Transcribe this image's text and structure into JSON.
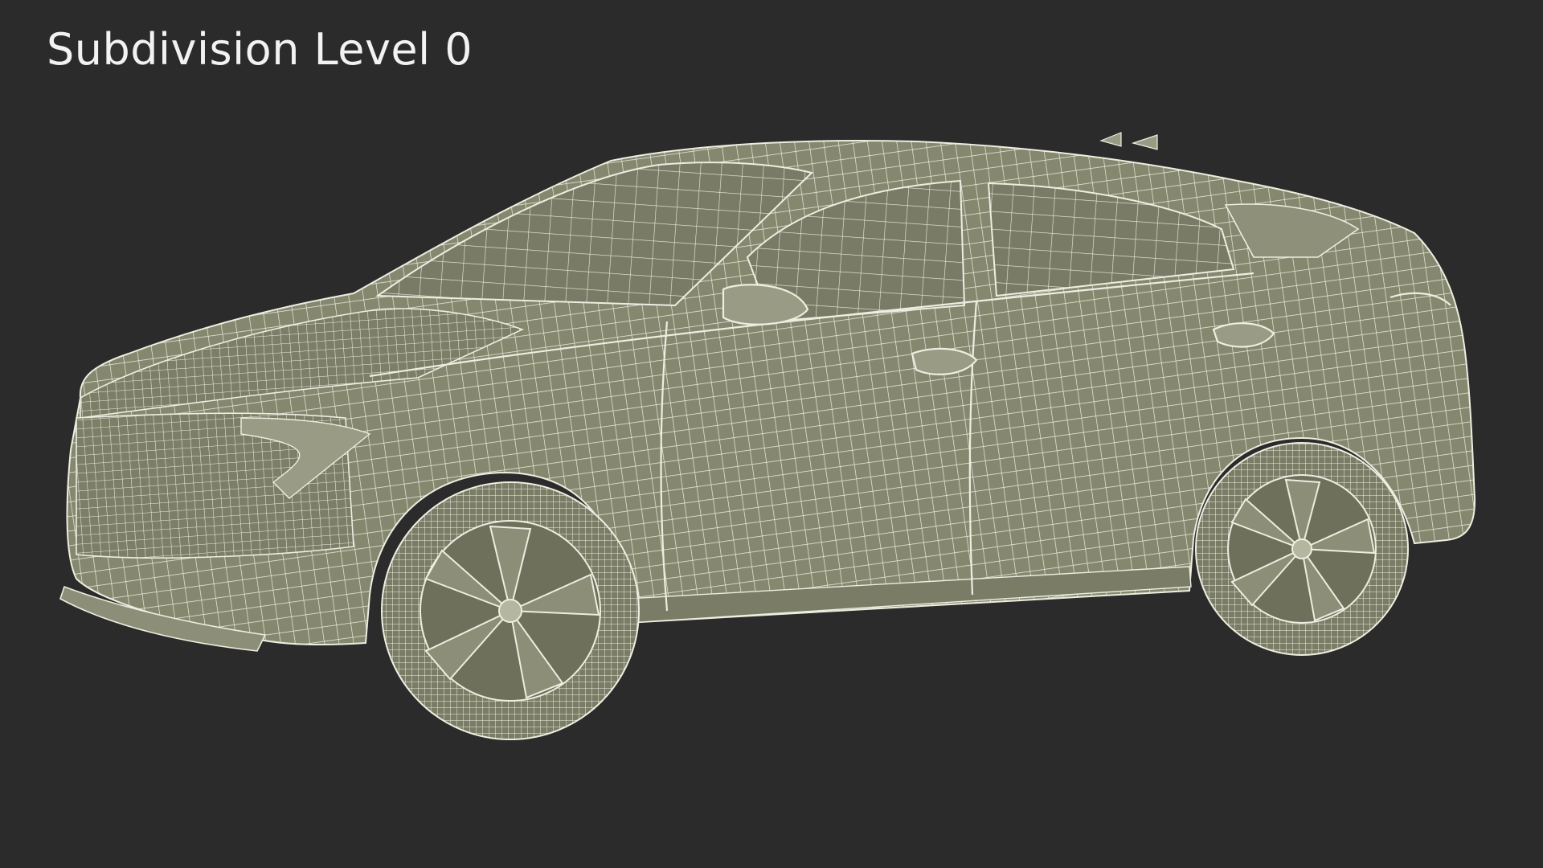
{
  "title": "Subdivision Level 0",
  "colors": {
    "background": "#2b2b2b",
    "mesh_fill": "#86876f",
    "mesh_fill_dark": "#6f705b",
    "wire": "#eceee0",
    "text": "#f2f2f2"
  },
  "subject": {
    "icon": "wireframe-car-icon"
  }
}
